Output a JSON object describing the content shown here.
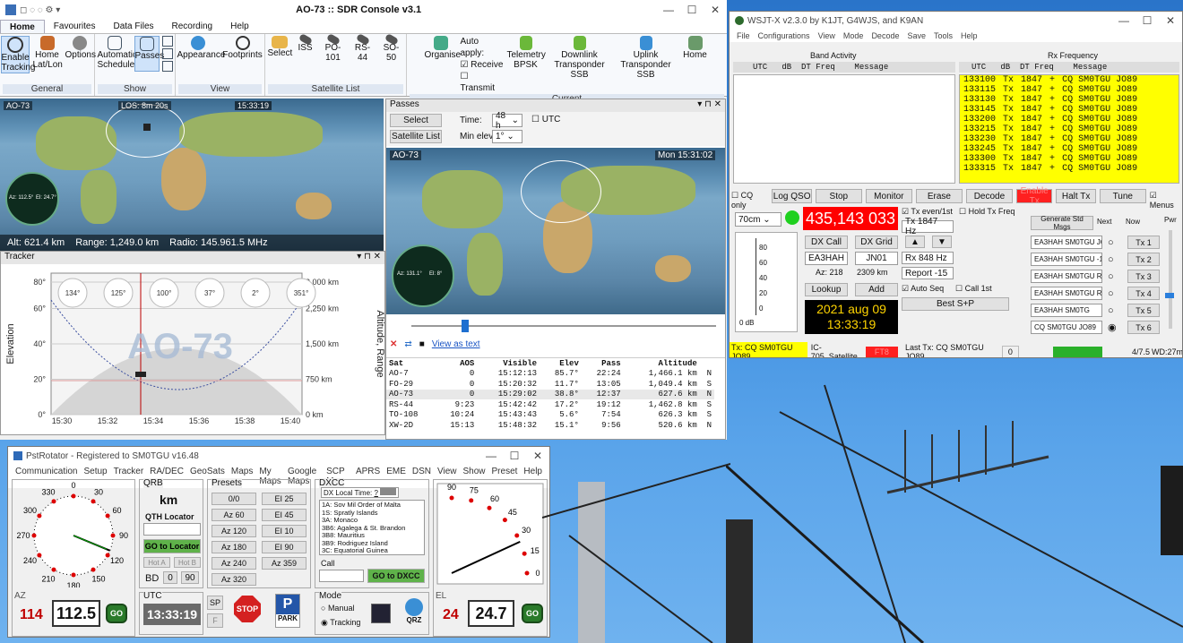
{
  "sdr": {
    "title": "AO-73 :: SDR Console v3.1",
    "tabs": [
      "Home",
      "Favourites",
      "Data Files",
      "Recording",
      "Help"
    ],
    "groups": [
      {
        "label": "General",
        "buttons": [
          "Enable Tracking",
          "Home Lat/Lon",
          "Options"
        ]
      },
      {
        "label": "Show",
        "buttons": [
          "Automatic Scheduler",
          "Passes"
        ]
      },
      {
        "label": "View",
        "buttons": [
          "Appearance",
          "Footprints"
        ]
      },
      {
        "label": "Satellite List",
        "buttons": [
          "Select",
          "ISS",
          "PO-101",
          "RS-44",
          "SO-50"
        ]
      },
      {
        "label": "Current",
        "buttons": [
          "Organise",
          "Telemetry BPSK",
          "Downlink Transponder SSB",
          "Uplink Transponder SSB",
          "Home"
        ]
      }
    ],
    "auto_apply": {
      "label": "Auto apply:",
      "receive": "Receive",
      "transmit": "Transmit"
    },
    "map1": {
      "sat": "AO-73",
      "los": "LOS: 8m 20s",
      "time": "15:33:19",
      "radar_az": "Az: 112.5°",
      "radar_el": "El: 24.7°",
      "status_alt": "Alt: 621.4 km",
      "status_range": "Range: 1,249.0 km",
      "status_radio": "Radio: 145.961.5 MHz"
    },
    "passes": {
      "title": "Passes",
      "select": "Select",
      "satlist": "Satellite List",
      "time_label": "Time:",
      "time_val": "48 h",
      "utc": "UTC",
      "minelev_label": "Min elev:",
      "minelev_val": "1°",
      "map_sat": "AO-73",
      "map_time": "Mon 15:31:02",
      "radar_az": "Az: 131.1°",
      "radar_el": "El: 8°",
      "view_as_text": "View as text",
      "headers": [
        "Sat",
        "AOS",
        "Visible",
        "Elev",
        "Pass",
        "Altitude",
        ""
      ],
      "rows": [
        [
          "AO-7",
          "0",
          "15:12:13",
          "85.7°",
          "22:24",
          "1,466.1 km",
          "N"
        ],
        [
          "FO-29",
          "0",
          "15:20:32",
          "11.7°",
          "13:05",
          "1,049.4 km",
          "S"
        ],
        [
          "AO-73",
          "0",
          "15:29:02",
          "38.8°",
          "12:37",
          "627.6 km",
          "N"
        ],
        [
          "RS-44",
          "9:23",
          "15:42:42",
          "17.2°",
          "19:12",
          "1,462.8 km",
          "S"
        ],
        [
          "TO-108",
          "10:24",
          "15:43:43",
          "5.6°",
          "7:54",
          "626.3 km",
          "S"
        ],
        [
          "XW-2D",
          "15:13",
          "15:48:32",
          "15.1°",
          "9:56",
          "520.6 km",
          "N"
        ]
      ]
    },
    "tracker": {
      "title": "Tracker",
      "sat": "AO-73",
      "ylabel": "Elevation",
      "y2label": "Altitude, Range",
      "yticks": [
        "80°",
        "60°",
        "40°",
        "20°",
        "0°"
      ],
      "y2ticks": [
        "3,000 km",
        "2,250 km",
        "1,500 km",
        "750 km",
        "0 km"
      ],
      "xticks": [
        "15:30",
        "15:32",
        "15:34",
        "15:36",
        "15:38",
        "15:40"
      ],
      "az_bubbles": [
        "134°",
        "125°",
        "100°",
        "37°",
        "2°",
        "351°"
      ]
    }
  },
  "wsjt": {
    "title": "WSJT-X  v2.3.0  by K1JT, G4WJS, and K9AN",
    "menu": [
      "File",
      "Configurations",
      "View",
      "Mode",
      "Decode",
      "Save",
      "Tools",
      "Help"
    ],
    "band_activity": "Band Activity",
    "rx_frequency": "Rx Frequency",
    "cols": [
      "UTC",
      "dB",
      "DT",
      "Freq",
      "Message"
    ],
    "rx_rows": [
      [
        "133100",
        "Tx",
        "1847",
        "+",
        "CQ SM0TGU JO89"
      ],
      [
        "133115",
        "Tx",
        "1847",
        "+",
        "CQ SM0TGU JO89"
      ],
      [
        "133130",
        "Tx",
        "1847",
        "+",
        "CQ SM0TGU JO89"
      ],
      [
        "133145",
        "Tx",
        "1847",
        "+",
        "CQ SM0TGU JO89"
      ],
      [
        "133200",
        "Tx",
        "1847",
        "+",
        "CQ SM0TGU JO89"
      ],
      [
        "133215",
        "Tx",
        "1847",
        "+",
        "CQ SM0TGU JO89"
      ],
      [
        "133230",
        "Tx",
        "1847",
        "+",
        "CQ SM0TGU JO89"
      ],
      [
        "133245",
        "Tx",
        "1847",
        "+",
        "CQ SM0TGU JO89"
      ],
      [
        "133300",
        "Tx",
        "1847",
        "+",
        "CQ SM0TGU JO89"
      ],
      [
        "133315",
        "Tx",
        "1847",
        "+",
        "CQ SM0TGU JO89"
      ]
    ],
    "buttons": [
      "CQ only",
      "Log QSO",
      "Stop",
      "Monitor",
      "Erase",
      "Decode",
      "Enable Tx",
      "Halt Tx",
      "Tune",
      "Menus"
    ],
    "band": "70cm",
    "freq": "435,143 033",
    "tx_even": "Tx even/1st",
    "hold_tx": "Hold Tx Freq",
    "tx_hz": "Tx 1847 Hz",
    "rx_hz": "Rx 848 Hz",
    "dx_call_lbl": "DX Call",
    "dx_grid_lbl": "DX Grid",
    "dx_call": "EA3HAH",
    "dx_grid": "JN01",
    "az": "Az: 218",
    "dist": "2309 km",
    "report": "Report -15",
    "lookup": "Lookup",
    "add": "Add",
    "auto_seq": "Auto Seq",
    "call_1st": "Call 1st",
    "best_sp": "Best S+P",
    "date": "2021 aug 09",
    "time": "13:33:19",
    "db": "0 dB",
    "meter_ticks": [
      "80",
      "60",
      "40",
      "20",
      "0"
    ],
    "gen_std": "Generate Std Msgs",
    "next": "Next",
    "now": "Now",
    "pwr": "Pwr",
    "msgs": [
      "EA3HAH SM0TGU JO",
      "EA3HAH SM0TGU -1",
      "EA3HAH SM0TGU R-",
      "EA3HAH SM0TGU RR",
      "EA3HAH SM0TG",
      "CQ SM0TGU JO89"
    ],
    "tx_buttons": [
      "Tx 1",
      "Tx 2",
      "Tx 3",
      "Tx 4",
      "Tx 5",
      "Tx 6"
    ],
    "status": {
      "tx": "Tx: CQ SM0TGU JO89",
      "rig": "IC-705_Satellite",
      "mode": "FT8",
      "last": "Last Tx: CQ SM0TGU JO89",
      "num": "0",
      "ratio": "4/7.5",
      "wd": "WD:27m"
    }
  },
  "pst": {
    "title": "PstRotator - Registered to SM0TGU   v16.48",
    "menu": [
      "Communication",
      "Setup",
      "Tracker",
      "RA/DEC",
      "GeoSats",
      "Maps",
      "My Maps",
      "Google Maps",
      "SCP Map",
      "APRS",
      "EME",
      "DSN",
      "View",
      "Show",
      "Preset",
      "Help"
    ],
    "qrb": "QRB",
    "km": "km",
    "qth": "QTH Locator",
    "go_loc": "GO to Locator",
    "hot_a": "Hot A",
    "hot_b": "Hot B",
    "bd": "BD",
    "bd0": "0",
    "bd90": "90",
    "presets": "Presets",
    "preset_btns": [
      "0/0",
      "EI 25",
      "Az 60",
      "EI 45",
      "Az 120",
      "EI 10",
      "Az 180",
      "EI 90",
      "Az 240",
      "Az 359",
      "Az 320"
    ],
    "dxcc": "DXCC",
    "dx_local": "DX Local Time:",
    "dx_list": [
      "1A:  Sov Mil Order of Malta",
      "1S:  Spratly Islands",
      "3A:  Monaco",
      "3B6:  Agalega & St. Brandon",
      "3B8:  Mauritius",
      "3B9:  Rodriguez Island",
      "3C:  Equatorial Guinea"
    ],
    "call": "Call",
    "go_dxcc": "GO to DXCC",
    "mode": "Mode",
    "manual": "Manual",
    "tracking": "Tracking",
    "qrz": "QRZ",
    "az_label": "AZ",
    "az_set": "114",
    "az_val": "112.5",
    "go": "GO",
    "utc": "UTC",
    "utc_val": "13:33:19",
    "sp": "SP",
    "f": "F",
    "stop": "STOP",
    "park": "PARK",
    "el_label": "EL",
    "el_set": "24",
    "el_val": "24.7",
    "az_dial": [
      "0",
      "30",
      "60",
      "90",
      "120",
      "150",
      "180",
      "210",
      "240",
      "270",
      "300",
      "330"
    ],
    "el_dial": [
      "90",
      "75",
      "60",
      "45",
      "30",
      "15",
      "0"
    ]
  }
}
